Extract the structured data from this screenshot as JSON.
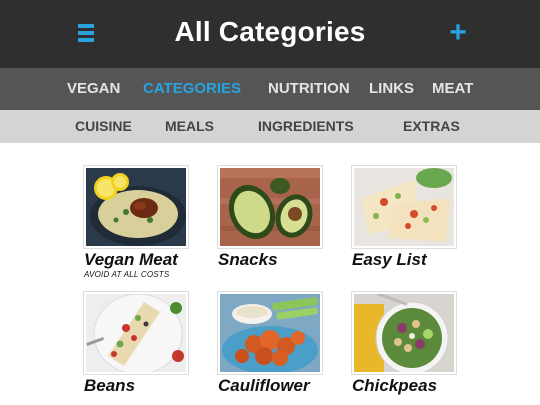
{
  "header": {
    "title": "All Categories",
    "menu_icon": "hamburger-menu-icon",
    "add_icon": "plus-icon",
    "accent_color": "#29a3e0"
  },
  "primary_nav": {
    "tabs": [
      {
        "label": "VEGAN",
        "active": false
      },
      {
        "label": "CATEGORIES",
        "active": true
      },
      {
        "label": "NUTRITION",
        "active": false
      },
      {
        "label": "LINKS",
        "active": false
      },
      {
        "label": "MEAT",
        "active": false
      }
    ]
  },
  "secondary_nav": {
    "tabs": [
      {
        "label": "CUISINE"
      },
      {
        "label": "MEALS"
      },
      {
        "label": "INGREDIENTS"
      },
      {
        "label": "EXTRAS"
      }
    ]
  },
  "categories": [
    {
      "label": "Vegan Meat",
      "subtitle": "AVOID AT ALL COSTS"
    },
    {
      "label": "Snacks"
    },
    {
      "label": "Easy List"
    },
    {
      "label": "Beans"
    },
    {
      "label": "Cauliflower"
    },
    {
      "label": "Chickpeas"
    }
  ]
}
